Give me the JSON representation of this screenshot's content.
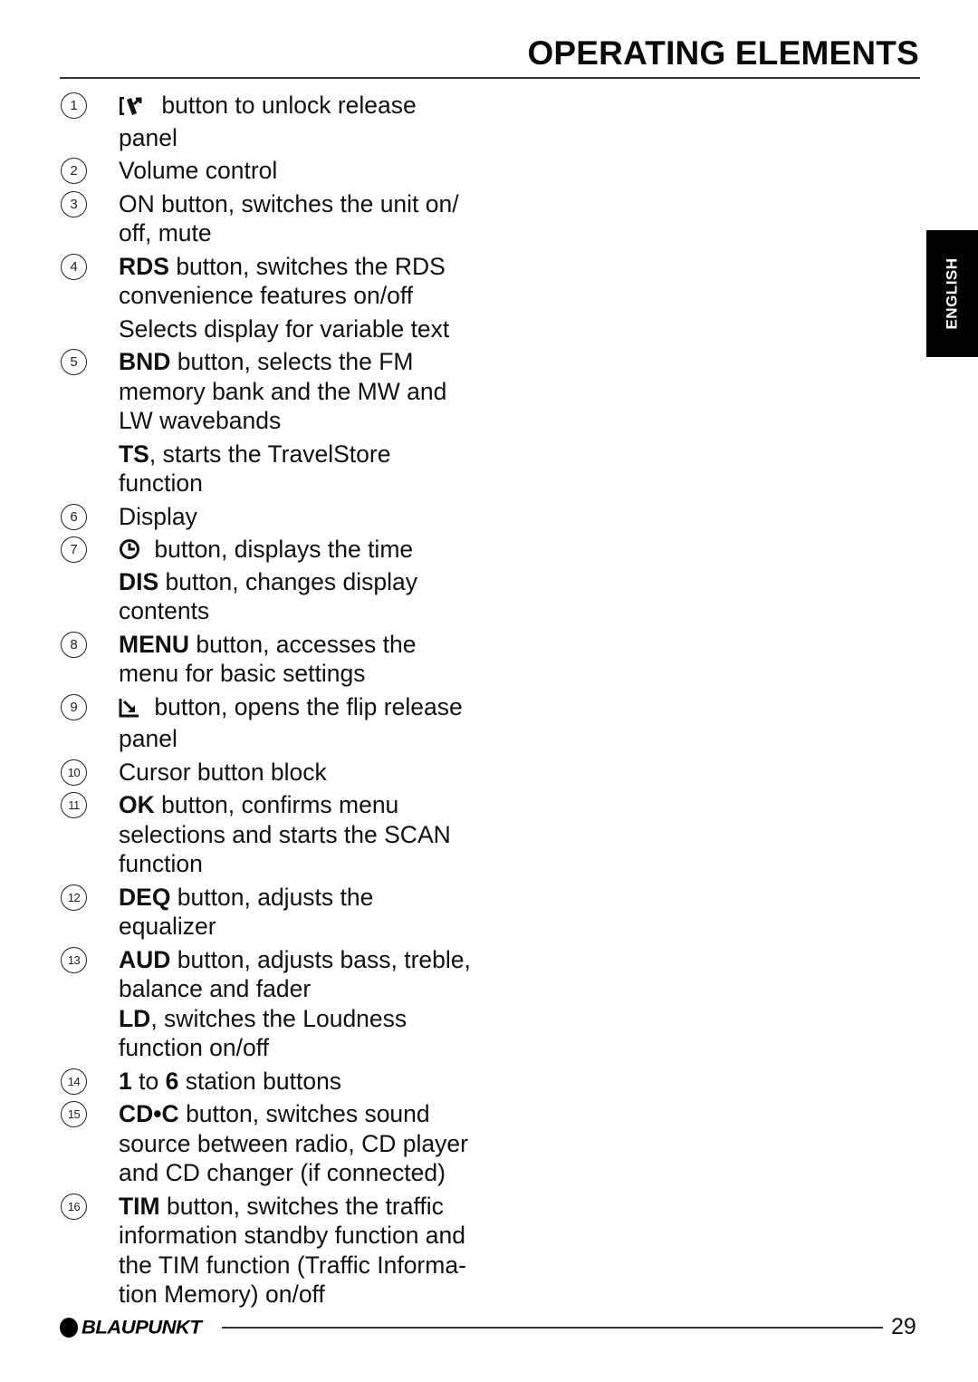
{
  "header": {
    "title": "OPERATING ELEMENTS"
  },
  "side_tab": {
    "label": "ENGLISH"
  },
  "items": [
    {
      "number": "1",
      "icon": "release-panel-unlock-icon",
      "lines": [
        [
          {
            "t": " button to unlock release"
          }
        ],
        [
          {
            "t": "panel"
          }
        ]
      ]
    },
    {
      "number": "2",
      "lines": [
        [
          {
            "t": "Volume control"
          }
        ]
      ]
    },
    {
      "number": "3",
      "lines": [
        [
          {
            "t": "ON button, switches the unit on/"
          }
        ],
        [
          {
            "t": "off, mute"
          }
        ]
      ]
    },
    {
      "number": "4",
      "lines": [
        [
          {
            "t": "RDS",
            "b": true
          },
          {
            "t": " button, switches the RDS"
          }
        ],
        [
          {
            "t": "convenience features on/off"
          }
        ],
        [
          {
            "t": "Selects display for variable text",
            "p": true
          }
        ]
      ]
    },
    {
      "number": "5",
      "lines": [
        [
          {
            "t": "BND",
            "b": true
          },
          {
            "t": " button, selects the FM"
          }
        ],
        [
          {
            "t": "memory bank and the MW and"
          }
        ],
        [
          {
            "t": "LW wavebands"
          }
        ],
        [
          {
            "t": "TS",
            "b": true,
            "p": true
          },
          {
            "t": ", starts the TravelStore"
          }
        ],
        [
          {
            "t": "function"
          }
        ]
      ]
    },
    {
      "number": "6",
      "lines": [
        [
          {
            "t": "Display"
          }
        ]
      ]
    },
    {
      "number": "7",
      "icon": "clock-icon",
      "lines": [
        [
          {
            "t": " button, displays the time"
          }
        ],
        [
          {
            "t": "DIS",
            "b": true
          },
          {
            "t": " button, changes display"
          }
        ],
        [
          {
            "t": "contents"
          }
        ]
      ]
    },
    {
      "number": "8",
      "lines": [
        [
          {
            "t": "MENU",
            "b": true
          },
          {
            "t": " button, accesses the"
          }
        ],
        [
          {
            "t": "menu for basic settings"
          }
        ]
      ]
    },
    {
      "number": "9",
      "icon": "flip-release-icon",
      "lines": [
        [
          {
            "t": " button, opens the flip release"
          }
        ],
        [
          {
            "t": "panel"
          }
        ]
      ]
    },
    {
      "number": "10",
      "lines": [
        [
          {
            "t": "Cursor button block"
          }
        ]
      ]
    },
    {
      "number": "11",
      "lines": [
        [
          {
            "t": "OK",
            "b": true
          },
          {
            "t": " button, confirms menu"
          }
        ],
        [
          {
            "t": "selections and starts the SCAN"
          }
        ],
        [
          {
            "t": "function"
          }
        ]
      ]
    },
    {
      "number": "12",
      "lines": [
        [
          {
            "t": "DEQ",
            "b": true
          },
          {
            "t": " button, adjusts the"
          }
        ],
        [
          {
            "t": "equalizer"
          }
        ]
      ]
    },
    {
      "number": "13",
      "lines": [
        [
          {
            "t": "AUD",
            "b": true
          },
          {
            "t": " button, adjusts bass, treble,"
          }
        ],
        [
          {
            "t": "balance and fader"
          }
        ],
        [
          {
            "t": "LD",
            "b": true
          },
          {
            "t": ", switches the Loudness"
          }
        ],
        [
          {
            "t": "function on/off"
          }
        ]
      ]
    },
    {
      "number": "14",
      "lines": [
        [
          {
            "t": "1",
            "b": true
          },
          {
            "t": " to "
          },
          {
            "t": "6",
            "b": true
          },
          {
            "t": " station buttons"
          }
        ]
      ]
    },
    {
      "number": "15",
      "lines": [
        [
          {
            "t": "CD•C",
            "b": true
          },
          {
            "t": " button, switches sound"
          }
        ],
        [
          {
            "t": "source between radio, CD player"
          }
        ],
        [
          {
            "t": "and CD changer (if connected)"
          }
        ]
      ]
    },
    {
      "number": "16",
      "lines": [
        [
          {
            "t": "TIM",
            "b": true
          },
          {
            "t": " button, switches the traffic"
          }
        ],
        [
          {
            "t": "information standby function and"
          }
        ],
        [
          {
            "t": "the TIM function (Traffic Informa-"
          }
        ],
        [
          {
            "t": "tion Memory) on/off"
          }
        ]
      ]
    }
  ],
  "footer": {
    "brand": "BLAUPUNKT",
    "page_number": "29"
  }
}
